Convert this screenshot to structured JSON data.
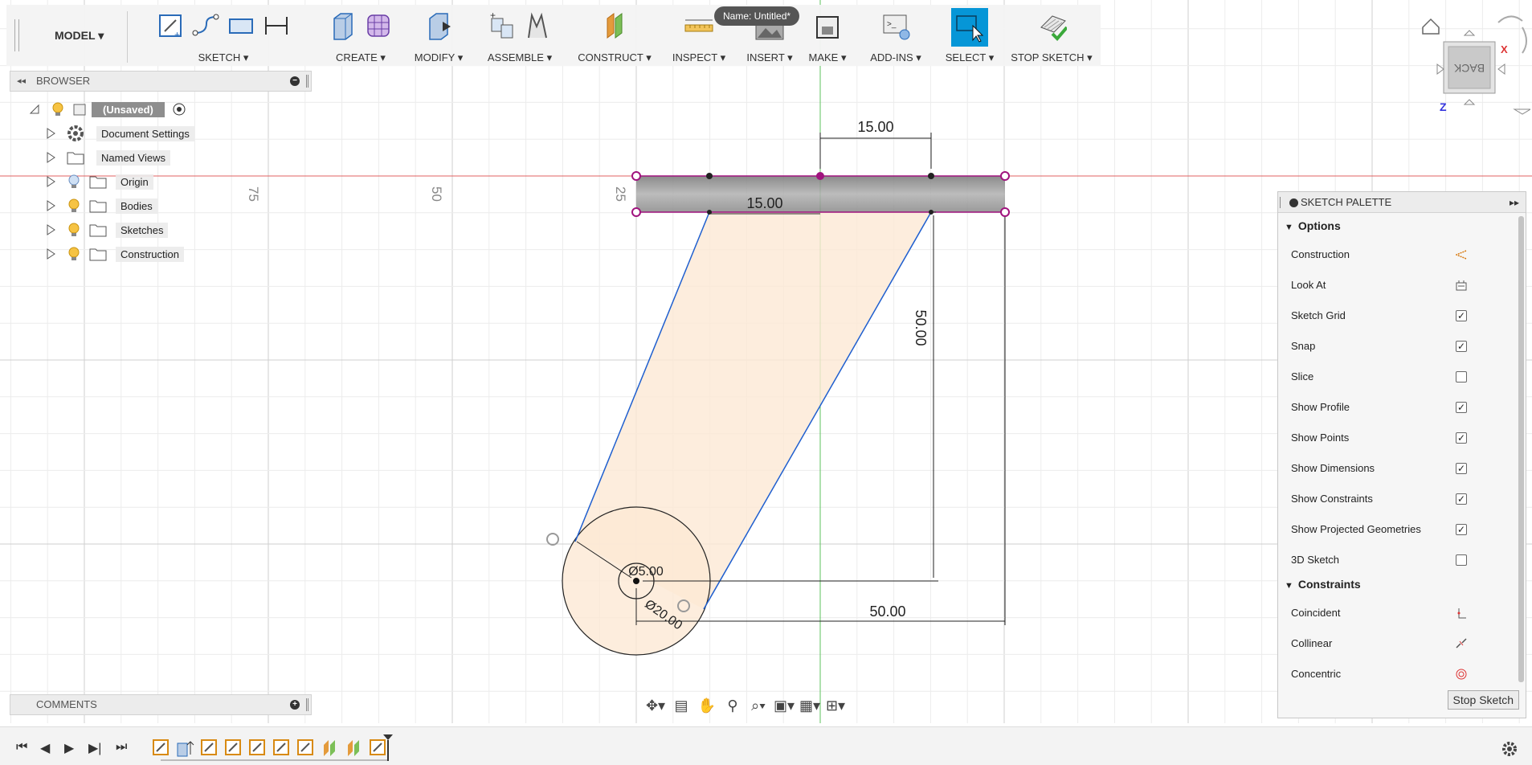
{
  "toolbar": {
    "workspace": "MODEL ▾",
    "groups": [
      {
        "label": "SKETCH ▾"
      },
      {
        "label": "CREATE ▾"
      },
      {
        "label": "MODIFY ▾"
      },
      {
        "label": "ASSEMBLE ▾"
      },
      {
        "label": "CONSTRUCT ▾"
      },
      {
        "label": "INSPECT ▾"
      },
      {
        "label": "INSERT ▾"
      },
      {
        "label": "MAKE ▾"
      },
      {
        "label": "ADD-INS ▾"
      },
      {
        "label": "SELECT ▾"
      },
      {
        "label": "STOP SKETCH ▾"
      }
    ]
  },
  "document": {
    "name_tooltip": "Name: Untitled*"
  },
  "browser": {
    "title": "BROWSER",
    "root_label": "(Unsaved)",
    "items": [
      {
        "label": "Document Settings",
        "icon": "gear-icon"
      },
      {
        "label": "Named Views",
        "icon": "folder-icon"
      },
      {
        "label": "Origin",
        "icon": "folder-icon"
      },
      {
        "label": "Bodies",
        "icon": "folder-icon"
      },
      {
        "label": "Sketches",
        "icon": "folder-icon"
      },
      {
        "label": "Construction",
        "icon": "folder-icon"
      }
    ]
  },
  "comments": {
    "title": "COMMENTS"
  },
  "canvas": {
    "ruler_labels": [
      "75",
      "50",
      "25"
    ],
    "dimensions": {
      "top_width": "15.00",
      "inner_width": "15.00",
      "height": "50.00",
      "bottom_offset": "50.00",
      "small_diameter": "Ø5.00",
      "large_diameter": "Ø20.00"
    }
  },
  "viewcube": {
    "face": "BACK",
    "axis_x": "X",
    "axis_z": "Z"
  },
  "palette": {
    "title": "SKETCH PALETTE",
    "options_header": "Options",
    "options": [
      {
        "label": "Construction",
        "control": "icon",
        "icon": "construction-icon"
      },
      {
        "label": "Look At",
        "control": "icon",
        "icon": "look-at-icon"
      },
      {
        "label": "Sketch Grid",
        "control": "checkbox",
        "checked": true
      },
      {
        "label": "Snap",
        "control": "checkbox",
        "checked": true
      },
      {
        "label": "Slice",
        "control": "checkbox",
        "checked": false
      },
      {
        "label": "Show Profile",
        "control": "checkbox",
        "checked": true
      },
      {
        "label": "Show Points",
        "control": "checkbox",
        "checked": true
      },
      {
        "label": "Show Dimensions",
        "control": "checkbox",
        "checked": true
      },
      {
        "label": "Show Constraints",
        "control": "checkbox",
        "checked": true
      },
      {
        "label": "Show Projected Geometries",
        "control": "checkbox",
        "checked": true
      },
      {
        "label": "3D Sketch",
        "control": "checkbox",
        "checked": false
      }
    ],
    "constraints_header": "Constraints",
    "constraints": [
      {
        "label": "Coincident",
        "icon": "coincident-icon"
      },
      {
        "label": "Collinear",
        "icon": "collinear-icon"
      },
      {
        "label": "Concentric",
        "icon": "concentric-icon"
      }
    ],
    "stop_button": "Stop Sketch"
  },
  "colors": {
    "accent": "#0696d7",
    "profile_fill": "#fde9d5",
    "sketch_line": "#1f5fcf",
    "constraint_point": "#a0137e",
    "x_axis": "#e06060",
    "y_axis": "#5ec25e"
  }
}
